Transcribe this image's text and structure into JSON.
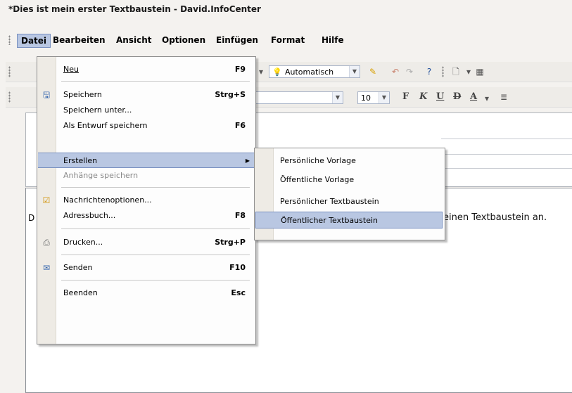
{
  "window": {
    "title": "*Dies ist mein erster Textbaustein - David.InfoCenter"
  },
  "menubar": {
    "items": [
      "Datei",
      "Bearbeiten",
      "Ansicht",
      "Optionen",
      "Einfügen",
      "Format",
      "Hilfe"
    ]
  },
  "toolbar1": {
    "color_combo": "Automatisch"
  },
  "toolbar2": {
    "font_size": "10",
    "bold": "F",
    "italic": "K",
    "underline": "U",
    "strike": "D",
    "font_color": "A"
  },
  "editor": {
    "text_fragment": "einen Textbaustein an.",
    "leading_char": "D"
  },
  "file_menu": {
    "new": {
      "label": "Neu",
      "shortcut": "F9"
    },
    "save": {
      "label": "Speichern",
      "shortcut": "Strg+S"
    },
    "save_as": {
      "label": "Speichern unter..."
    },
    "save_draft": {
      "label": "Als Entwurf speichern",
      "shortcut": "F6"
    },
    "create": {
      "label": "Erstellen"
    },
    "save_attachments": {
      "label": "Anhänge speichern"
    },
    "message_options": {
      "label": "Nachrichtenoptionen..."
    },
    "address_book": {
      "label": "Adressbuch...",
      "shortcut": "F8"
    },
    "print": {
      "label": "Drucken...",
      "shortcut": "Strg+P"
    },
    "send": {
      "label": "Senden",
      "shortcut": "F10"
    },
    "exit": {
      "label": "Beenden",
      "shortcut": "Esc"
    }
  },
  "create_submenu": {
    "items": [
      "Persönliche Vorlage",
      "Öffentliche Vorlage",
      "Persönlicher Textbaustein",
      "Öffentlicher Textbaustein"
    ]
  },
  "colors": {
    "highlight": "#b9c7e2",
    "highlight_border": "#7890c0"
  }
}
